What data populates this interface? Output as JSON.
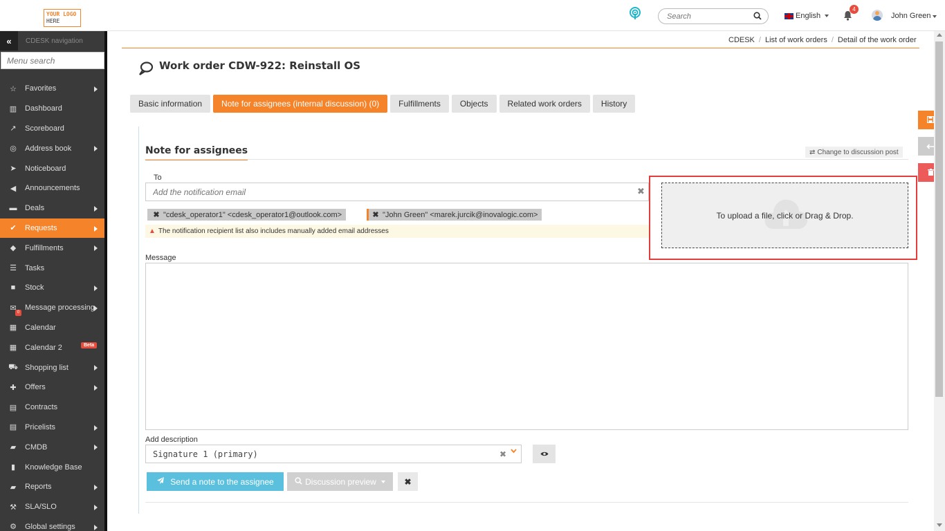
{
  "logo": {
    "line1": "YOUR LOGO",
    "line2": "HERE"
  },
  "header": {
    "search_placeholder": "Search",
    "language": "English",
    "notification_count": "4",
    "user_name": "John Green"
  },
  "sidebar": {
    "title": "CDESK navigation",
    "menu_search_placeholder": "Menu search",
    "items": [
      {
        "label": "Favorites",
        "icon": "star-icon",
        "arrow": true
      },
      {
        "label": "Dashboard",
        "icon": "bar-chart-icon",
        "arrow": false
      },
      {
        "label": "Scoreboard",
        "icon": "line-chart-icon",
        "arrow": false
      },
      {
        "label": "Address book",
        "icon": "user-icon",
        "arrow": true
      },
      {
        "label": "Noticeboard",
        "icon": "paper-plane-icon",
        "arrow": false
      },
      {
        "label": "Announcements",
        "icon": "bullhorn-icon",
        "arrow": false
      },
      {
        "label": "Deals",
        "icon": "card-icon",
        "arrow": true
      },
      {
        "label": "Requests",
        "icon": "check-circle-icon",
        "arrow": true,
        "active": true
      },
      {
        "label": "Fulfillments",
        "icon": "cube-icon",
        "arrow": true
      },
      {
        "label": "Tasks",
        "icon": "tasks-icon",
        "arrow": false
      },
      {
        "label": "Stock",
        "icon": "box-icon",
        "arrow": true
      },
      {
        "label": "Message processing",
        "icon": "envelope-icon",
        "arrow": true,
        "badge": "0"
      },
      {
        "label": "Calendar",
        "icon": "calendar-icon",
        "arrow": false
      },
      {
        "label": "Calendar 2",
        "icon": "calendar-icon",
        "arrow": false,
        "tag": "Beta"
      },
      {
        "label": "Shopping list",
        "icon": "cart-icon",
        "arrow": true
      },
      {
        "label": "Offers",
        "icon": "gift-icon",
        "arrow": true
      },
      {
        "label": "Contracts",
        "icon": "file-icon",
        "arrow": false
      },
      {
        "label": "Pricelists",
        "icon": "file-icon",
        "arrow": true
      },
      {
        "label": "CMDB",
        "icon": "folder-icon",
        "arrow": true
      },
      {
        "label": "Knowledge Base",
        "icon": "book-icon",
        "arrow": false
      },
      {
        "label": "Reports",
        "icon": "folder-icon",
        "arrow": true
      },
      {
        "label": "SLA/SLO",
        "icon": "gavel-icon",
        "arrow": true
      },
      {
        "label": "Global settings",
        "icon": "cogs-icon",
        "arrow": true
      }
    ]
  },
  "breadcrumb": [
    "CDESK",
    "List of work orders",
    "Detail of the work order"
  ],
  "page": {
    "title": "Work order CDW-922: Reinstall OS"
  },
  "tabs": [
    {
      "label": "Basic information"
    },
    {
      "label": "Note for assignees (internal discussion) (0)",
      "active": true
    },
    {
      "label": "Fulfillments"
    },
    {
      "label": "Objects"
    },
    {
      "label": "Related work orders"
    },
    {
      "label": "History"
    }
  ],
  "note": {
    "section_title": "Note for assignees",
    "change_link": "Change to discussion post",
    "to_label": "To",
    "email_placeholder": "Add the notification email",
    "recipients": [
      "\"cdesk_operator1\" <cdesk_operator1@outlook.com>",
      "\"John Green\" <marek.jurcik@inovalogic.com>"
    ],
    "warning": "The notification recipient list also includes manually added email addresses",
    "upload_text": "To upload a file, click or Drag & Drop.",
    "message_label": "Message",
    "message_value": "",
    "description_label": "Add description",
    "description_value": "Signature 1 (primary)",
    "send_label": "Send a note to the assignee",
    "preview_label": "Discussion preview"
  },
  "colors": {
    "accent": "#f4832a",
    "sidebar_bg": "#3a3a3a",
    "send_button": "#5bc0de",
    "delete": "#ec5a5a",
    "highlight": "#e23c3c"
  }
}
